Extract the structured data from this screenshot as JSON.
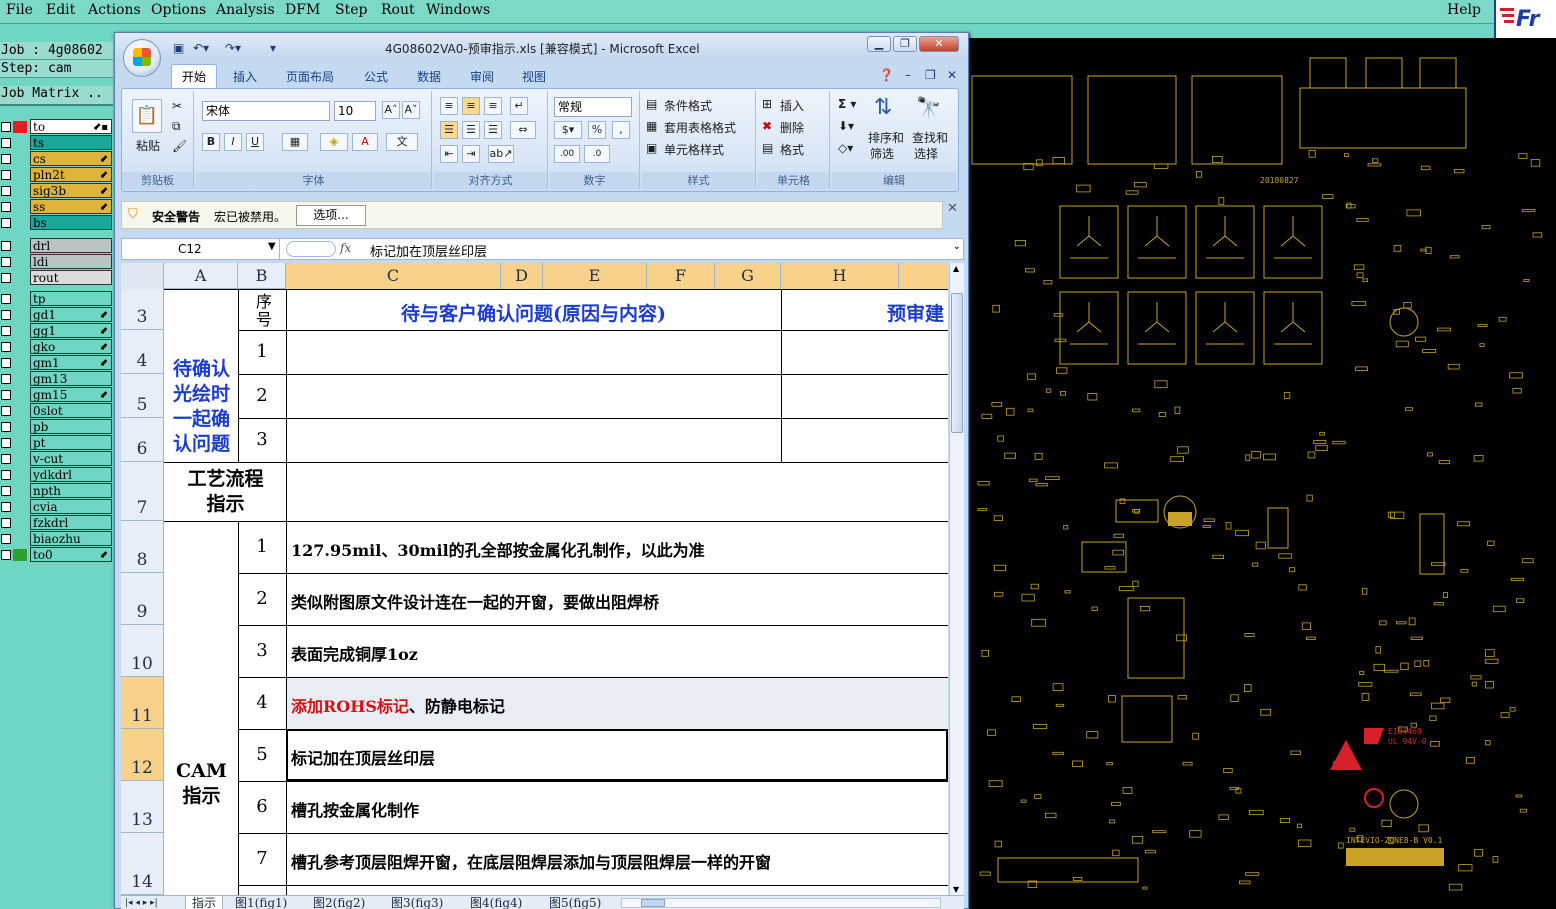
{
  "cam": {
    "menu": [
      "File",
      "Edit",
      "Actions",
      "Options",
      "Analysis",
      "DFM",
      "Step",
      "Rout",
      "Windows"
    ],
    "help": "Help",
    "job_line": "Job : 4g08602",
    "step_line": "Step: cam",
    "job_matrix": "Job Matrix ..",
    "layers": [
      {
        "name": "to",
        "color": "#ffffff",
        "swatch": "#e02020",
        "mark": "⬋▪"
      },
      {
        "name": "ts",
        "color": "#19a89a",
        "swatch": "#6fd6c4",
        "mark": ""
      },
      {
        "name": "cs",
        "color": "#e0b43a",
        "swatch": "#6fd6c4",
        "mark": "⬋"
      },
      {
        "name": "pln2t",
        "color": "#e0b43a",
        "swatch": "#6fd6c4",
        "mark": "⬋"
      },
      {
        "name": "sig3b",
        "color": "#e0b43a",
        "swatch": "#6fd6c4",
        "mark": "⬋"
      },
      {
        "name": "ss",
        "color": "#e0b43a",
        "swatch": "#6fd6c4",
        "mark": "⬋"
      },
      {
        "name": "bs",
        "color": "#19a89a",
        "swatch": "#6fd6c4",
        "mark": ""
      },
      {
        "name": "drl",
        "color": "#b9c3c3",
        "swatch": "#6fd6c4",
        "mark": ""
      },
      {
        "name": "ldi",
        "color": "#b9c3c3",
        "swatch": "#6fd6c4",
        "mark": ""
      },
      {
        "name": "rout",
        "color": "#dcdcdc",
        "swatch": "#6fd6c4",
        "mark": ""
      },
      {
        "name": "tp",
        "color": "#6fd6c4",
        "swatch": "#6fd6c4",
        "mark": ""
      },
      {
        "name": "gd1",
        "color": "#6fd6c4",
        "swatch": "#6fd6c4",
        "mark": "⬋"
      },
      {
        "name": "gg1",
        "color": "#6fd6c4",
        "swatch": "#6fd6c4",
        "mark": "⬋"
      },
      {
        "name": "gko",
        "color": "#6fd6c4",
        "swatch": "#6fd6c4",
        "mark": "⬋"
      },
      {
        "name": "gm1",
        "color": "#6fd6c4",
        "swatch": "#6fd6c4",
        "mark": "⬋"
      },
      {
        "name": "gm13",
        "color": "#6fd6c4",
        "swatch": "#6fd6c4",
        "mark": ""
      },
      {
        "name": "gm15",
        "color": "#6fd6c4",
        "swatch": "#6fd6c4",
        "mark": "⬋"
      },
      {
        "name": "0slot",
        "color": "#6fd6c4",
        "swatch": "#6fd6c4",
        "mark": ""
      },
      {
        "name": "pb",
        "color": "#6fd6c4",
        "swatch": "#6fd6c4",
        "mark": ""
      },
      {
        "name": "pt",
        "color": "#6fd6c4",
        "swatch": "#6fd6c4",
        "mark": ""
      },
      {
        "name": "v-cut",
        "color": "#6fd6c4",
        "swatch": "#6fd6c4",
        "mark": ""
      },
      {
        "name": "ydkdrl",
        "color": "#6fd6c4",
        "swatch": "#6fd6c4",
        "mark": ""
      },
      {
        "name": "npth",
        "color": "#6fd6c4",
        "swatch": "#6fd6c4",
        "mark": ""
      },
      {
        "name": "cvia",
        "color": "#6fd6c4",
        "swatch": "#6fd6c4",
        "mark": ""
      },
      {
        "name": "fzkdrl",
        "color": "#6fd6c4",
        "swatch": "#6fd6c4",
        "mark": ""
      },
      {
        "name": "biaozhu",
        "color": "#6fd6c4",
        "swatch": "#6fd6c4",
        "mark": ""
      },
      {
        "name": "to0",
        "color": "#6fd6c4",
        "swatch": "#2ea02e",
        "mark": "⬋"
      }
    ],
    "pcb_texts": {
      "date": "20180827",
      "ul": "E184469",
      "ul2": "UL 94V-0",
      "board": "INTEVIO-ZONE8-B V0.1"
    }
  },
  "excel": {
    "title": "4G08602VA0-预审指示.xls [兼容模式] - Microsoft Excel",
    "tabs": [
      "开始",
      "插入",
      "页面布局",
      "公式",
      "数据",
      "审阅",
      "视图"
    ],
    "ribbon": {
      "paste": "粘贴",
      "clipboard": "剪贴板",
      "font_name": "宋体",
      "font_size": "10",
      "font": "字体",
      "align": "对齐方式",
      "number_format": "常规",
      "number": "数字",
      "cond_format": "条件格式",
      "table_format": "套用表格格式",
      "cell_style": "单元格样式",
      "styles": "样式",
      "insert": "插入",
      "delete": "删除",
      "format": "格式",
      "cells": "单元格",
      "sort": "排序和",
      "sort2": "筛选",
      "find": "查找和",
      "find2": "选择",
      "edit": "编辑"
    },
    "security": {
      "label": "安全警告",
      "msg": "宏已被禁用。",
      "btn": "选项..."
    },
    "namebox": "C12",
    "formula": "标记加在顶层丝印层",
    "columns": [
      "A",
      "B",
      "C",
      "D",
      "E",
      "F",
      "G",
      "H"
    ],
    "rows": [
      "3",
      "4",
      "5",
      "6",
      "7",
      "8",
      "9",
      "10",
      "11",
      "12",
      "13",
      "14"
    ],
    "header_seq": "序号",
    "header_issue": "待与客户确认问题(原因与内容)",
    "header_suggest": "预审建",
    "confirm_label": [
      "待确认",
      "光绘时",
      "一起确",
      "认问题"
    ],
    "confirm_nums": [
      "1",
      "2",
      "3"
    ],
    "flow_label": [
      "工艺流程",
      "指示"
    ],
    "cam_label": [
      "CAM",
      "指示"
    ],
    "instructions": [
      {
        "n": "1",
        "text": "127.95mil、30mil的孔全部按金属化孔制作，以此为准"
      },
      {
        "n": "2",
        "text": "类似附图原文件设计连在一起的开窗，要做出阻焊桥"
      },
      {
        "n": "3",
        "text": "表面完成铜厚1oz"
      },
      {
        "n": "4",
        "text_red": "添加ROHS标记",
        "text": "、防静电标记"
      },
      {
        "n": "5",
        "text": "标记加在顶层丝印层"
      },
      {
        "n": "6",
        "text": "槽孔按金属化制作"
      },
      {
        "n": "7",
        "text": "槽孔参考顶层阻焊开窗，在底层阻焊层添加与顶层阻焊层一样的开窗"
      }
    ],
    "sheets": [
      "指示",
      "图1(fig1)",
      "图2(fig2)",
      "图3(fig3)",
      "图4(fig4)",
      "图5(fig5)"
    ]
  }
}
